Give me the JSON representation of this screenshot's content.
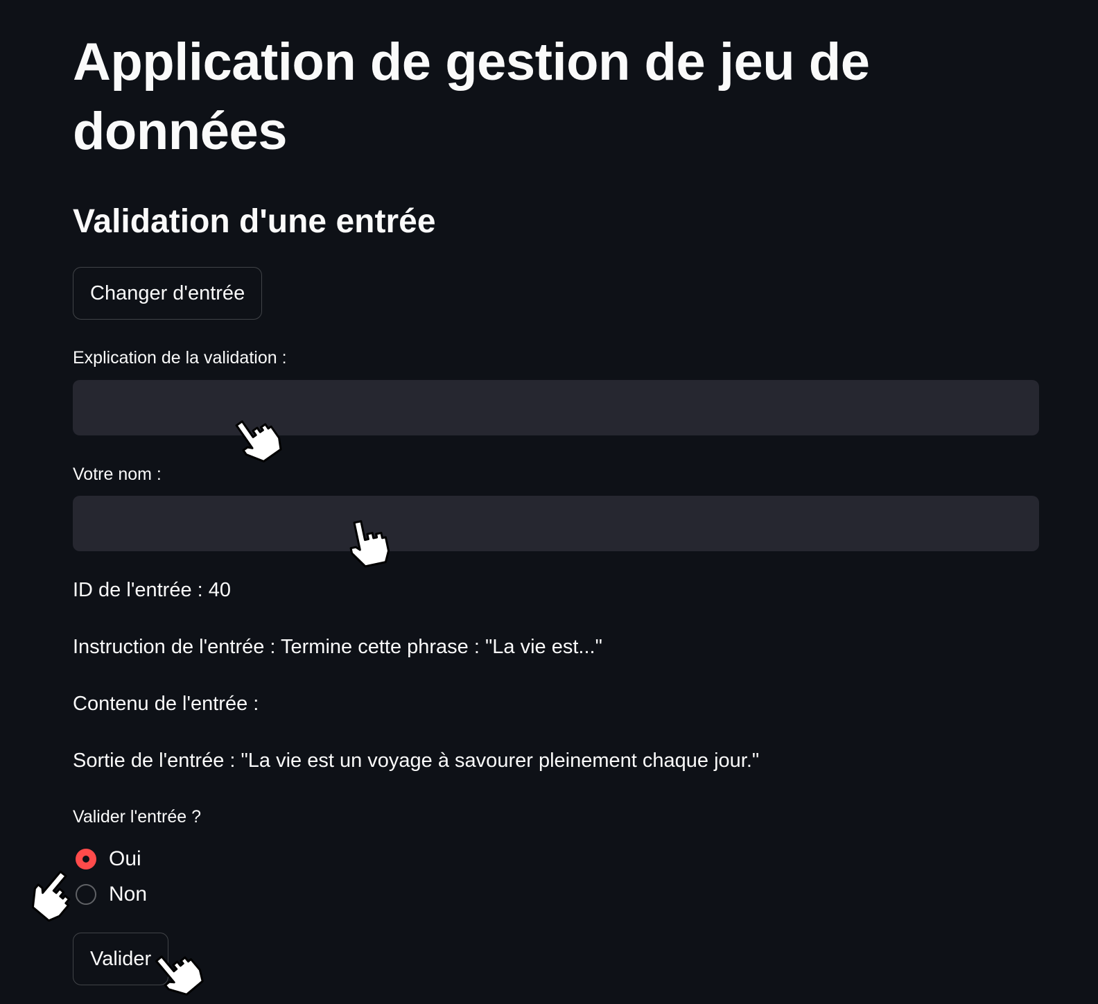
{
  "header": {
    "title": "Application de gestion de jeu de données",
    "subtitle": "Validation d'une entrée"
  },
  "actions": {
    "change_entry_label": "Changer d'entrée",
    "validate_label": "Valider"
  },
  "form": {
    "explanation_label": "Explication de la validation :",
    "explanation_value": "",
    "name_label": "Votre nom :",
    "name_value": ""
  },
  "entry": {
    "id_text": "ID de l'entrée : 40",
    "instruction_text": "Instruction de l'entrée : Termine cette phrase : \"La vie est...\"",
    "content_text": "Contenu de l'entrée :",
    "output_text": "Sortie de l'entrée : \"La vie est un voyage à savourer pleinement chaque jour.\""
  },
  "validation": {
    "question": "Valider l'entrée ?",
    "options": [
      "Oui",
      "Non"
    ],
    "selected": "Oui"
  },
  "colors": {
    "background": "#0e1117",
    "field": "#262730",
    "accent": "#ff4b4b",
    "text": "#fafafa"
  },
  "icons": [
    "pointing-hand-cursor-icon"
  ]
}
